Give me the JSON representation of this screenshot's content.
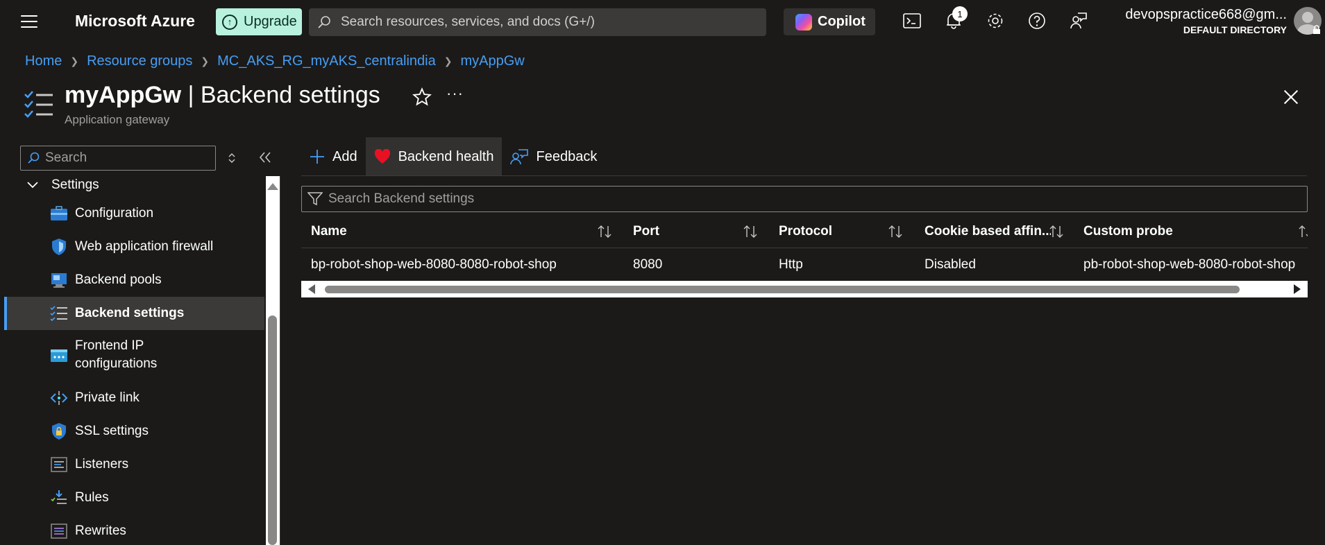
{
  "topbar": {
    "brand": "Microsoft Azure",
    "upgrade_label": "Upgrade",
    "search_placeholder": "Search resources, services, and docs (G+/)",
    "copilot_label": "Copilot",
    "notification_count": "1",
    "user_email": "devopspractice668@gm...",
    "user_directory": "DEFAULT DIRECTORY"
  },
  "breadcrumb": [
    "Home",
    "Resource groups",
    "MC_AKS_RG_myAKS_centralindia",
    "myAppGw"
  ],
  "header": {
    "resource_name": "myAppGw",
    "title_suffix": " | Backend settings",
    "subtitle": "Application gateway",
    "more": "···"
  },
  "sidebar": {
    "search_placeholder": "Search",
    "section": "Settings",
    "items": [
      {
        "label": "Configuration",
        "icon": "configuration-icon"
      },
      {
        "label": "Web application firewall",
        "icon": "waf-shield-icon"
      },
      {
        "label": "Backend pools",
        "icon": "backend-pools-icon"
      },
      {
        "label": "Backend settings",
        "icon": "backend-settings-icon",
        "active": true
      },
      {
        "label": "Frontend IP configurations",
        "icon": "frontend-ip-icon"
      },
      {
        "label": "Private link",
        "icon": "private-link-icon"
      },
      {
        "label": "SSL settings",
        "icon": "ssl-shield-icon"
      },
      {
        "label": "Listeners",
        "icon": "listeners-icon"
      },
      {
        "label": "Rules",
        "icon": "rules-icon"
      },
      {
        "label": "Rewrites",
        "icon": "rewrites-icon"
      }
    ]
  },
  "commands": {
    "add": "Add",
    "backend_health": "Backend health",
    "feedback": "Feedback"
  },
  "filter": {
    "placeholder": "Search Backend settings"
  },
  "table": {
    "columns": [
      "Name",
      "Port",
      "Protocol",
      "Cookie based affin...",
      "Custom probe"
    ],
    "rows": [
      [
        "bp-robot-shop-web-8080-8080-robot-shop",
        "8080",
        "Http",
        "Disabled",
        "pb-robot-shop-web-8080-robot-shop"
      ]
    ]
  },
  "colors": {
    "accent": "#479ef5",
    "upgrade_bg": "#b8f2df",
    "heart": "#e81123",
    "background": "#1b1a19"
  }
}
